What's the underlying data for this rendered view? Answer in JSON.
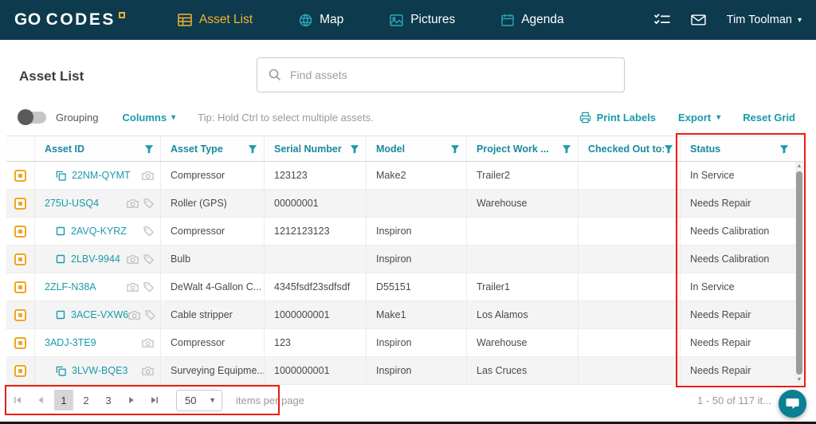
{
  "navbar": {
    "logo": {
      "bold": "GO",
      "rest": "CODES"
    },
    "items": [
      {
        "id": "asset-list",
        "label": "Asset List",
        "active": true
      },
      {
        "id": "map",
        "label": "Map",
        "active": false
      },
      {
        "id": "pictures",
        "label": "Pictures",
        "active": false
      },
      {
        "id": "agenda",
        "label": "Agenda",
        "active": false
      }
    ],
    "user_name": "Tim Toolman"
  },
  "header": {
    "title": "Asset List",
    "search_placeholder": "Find assets"
  },
  "toolbar": {
    "grouping_label": "Grouping",
    "columns_label": "Columns",
    "tip": "Tip: Hold Ctrl to select multiple assets.",
    "print_labels_label": "Print Labels",
    "export_label": "Export",
    "reset_grid_label": "Reset Grid"
  },
  "table": {
    "columns": [
      "Asset ID",
      "Asset Type",
      "Serial Number",
      "Model",
      "Project Work ...",
      "Checked Out to:",
      "Status"
    ],
    "rows": [
      {
        "asset_id": "22NM-QYMT",
        "prefix_icon": "copy",
        "trailing_icons": [
          "camera"
        ],
        "asset_type": "Compressor",
        "serial_number": "123123",
        "model": "Make2",
        "project": "Trailer2",
        "checked_out_to": "",
        "status": "In Service"
      },
      {
        "asset_id": "275U-USQ4",
        "prefix_icon": null,
        "trailing_icons": [
          "camera",
          "tag"
        ],
        "asset_type": "Roller (GPS)",
        "serial_number": "00000001",
        "model": "",
        "project": "Warehouse",
        "checked_out_to": "",
        "status": "Needs Repair"
      },
      {
        "asset_id": "2AVQ-KYRZ",
        "prefix_icon": "square",
        "trailing_icons": [
          "tag"
        ],
        "asset_type": "Compressor",
        "serial_number": "1212123123",
        "model": "Inspiron",
        "project": "",
        "checked_out_to": "",
        "status": "Needs Calibration"
      },
      {
        "asset_id": "2LBV-9944",
        "prefix_icon": "square",
        "trailing_icons": [
          "camera",
          "tag"
        ],
        "asset_type": "Bulb",
        "serial_number": "",
        "model": "Inspiron",
        "project": "",
        "checked_out_to": "",
        "status": "Needs Calibration"
      },
      {
        "asset_id": "2ZLF-N38A",
        "prefix_icon": null,
        "trailing_icons": [
          "camera",
          "tag"
        ],
        "asset_type": "DeWalt 4-Gallon C...",
        "serial_number": "4345fsdf23sdfsdf",
        "model": "D55151",
        "project": "Trailer1",
        "checked_out_to": "",
        "status": "In Service"
      },
      {
        "asset_id": "3ACE-VXW6",
        "prefix_icon": "square",
        "trailing_icons": [
          "camera",
          "tag"
        ],
        "asset_type": "Cable stripper",
        "serial_number": "1000000001",
        "model": "Make1",
        "project": "Los Alamos",
        "checked_out_to": "",
        "status": "Needs Repair"
      },
      {
        "asset_id": "3ADJ-3TE9",
        "prefix_icon": null,
        "trailing_icons": [
          "camera"
        ],
        "asset_type": "Compressor",
        "serial_number": "123",
        "model": "Inspiron",
        "project": "Warehouse",
        "checked_out_to": "",
        "status": "Needs Repair"
      },
      {
        "asset_id": "3LVW-BQE3",
        "prefix_icon": "copy",
        "trailing_icons": [
          "camera"
        ],
        "asset_type": "Surveying Equipme...",
        "serial_number": "1000000001",
        "model": "Inspiron",
        "project": "Las Cruces",
        "checked_out_to": "",
        "status": "Needs Repair"
      }
    ]
  },
  "pagination": {
    "pages": [
      "1",
      "2",
      "3"
    ],
    "current_page": "1",
    "page_size": "50",
    "items_per_page_label": "items per page",
    "range_label": "1 - 50 of 117 it..."
  },
  "colors": {
    "navbar_bg": "#0d3a4d",
    "accent_teal": "#1a9aaa",
    "active_gold": "#f9b233",
    "annotation_red": "#ec1c0d",
    "qr_yellow": "#f2a51f"
  }
}
